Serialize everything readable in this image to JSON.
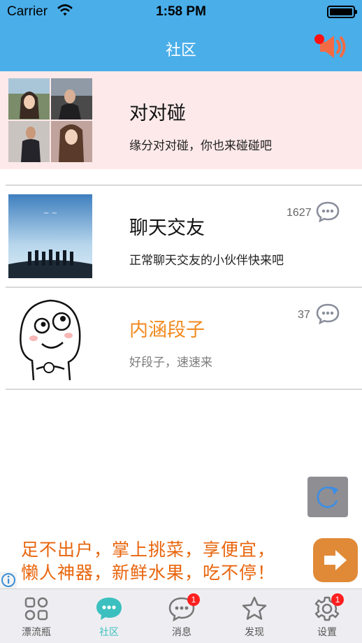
{
  "status_bar": {
    "carrier": "Carrier",
    "time": "1:58 PM"
  },
  "nav": {
    "title": "社区",
    "speaker_icon": "speaker-icon"
  },
  "rows": [
    {
      "title": "对对碰",
      "subtitle": "缘分对对碰，你也来碰碰吧",
      "count": ""
    },
    {
      "title": "聊天交友",
      "subtitle": "正常聊天交友的小伙伴快来吧",
      "count": "1627"
    },
    {
      "title": "内涵段子",
      "subtitle": "好段子，速速来",
      "count": "37"
    }
  ],
  "ad": {
    "line1": "足不出户，掌上挑菜，享便宜，",
    "line2": "懒人神器，新鲜水果，吃不停！"
  },
  "tabs": [
    {
      "label": "漂流瓶",
      "icon": "grid-icon",
      "badge": ""
    },
    {
      "label": "社区",
      "icon": "chat-bubble-icon",
      "badge": ""
    },
    {
      "label": "消息",
      "icon": "message-icon",
      "badge": "1"
    },
    {
      "label": "发现",
      "icon": "star-icon",
      "badge": ""
    },
    {
      "label": "设置",
      "icon": "gear-icon",
      "badge": "1"
    }
  ],
  "colors": {
    "nav_bg": "#4aaee9",
    "accent": "#3cc0bf",
    "orange": "#f18a1f",
    "badge": "#ff1f1f"
  }
}
